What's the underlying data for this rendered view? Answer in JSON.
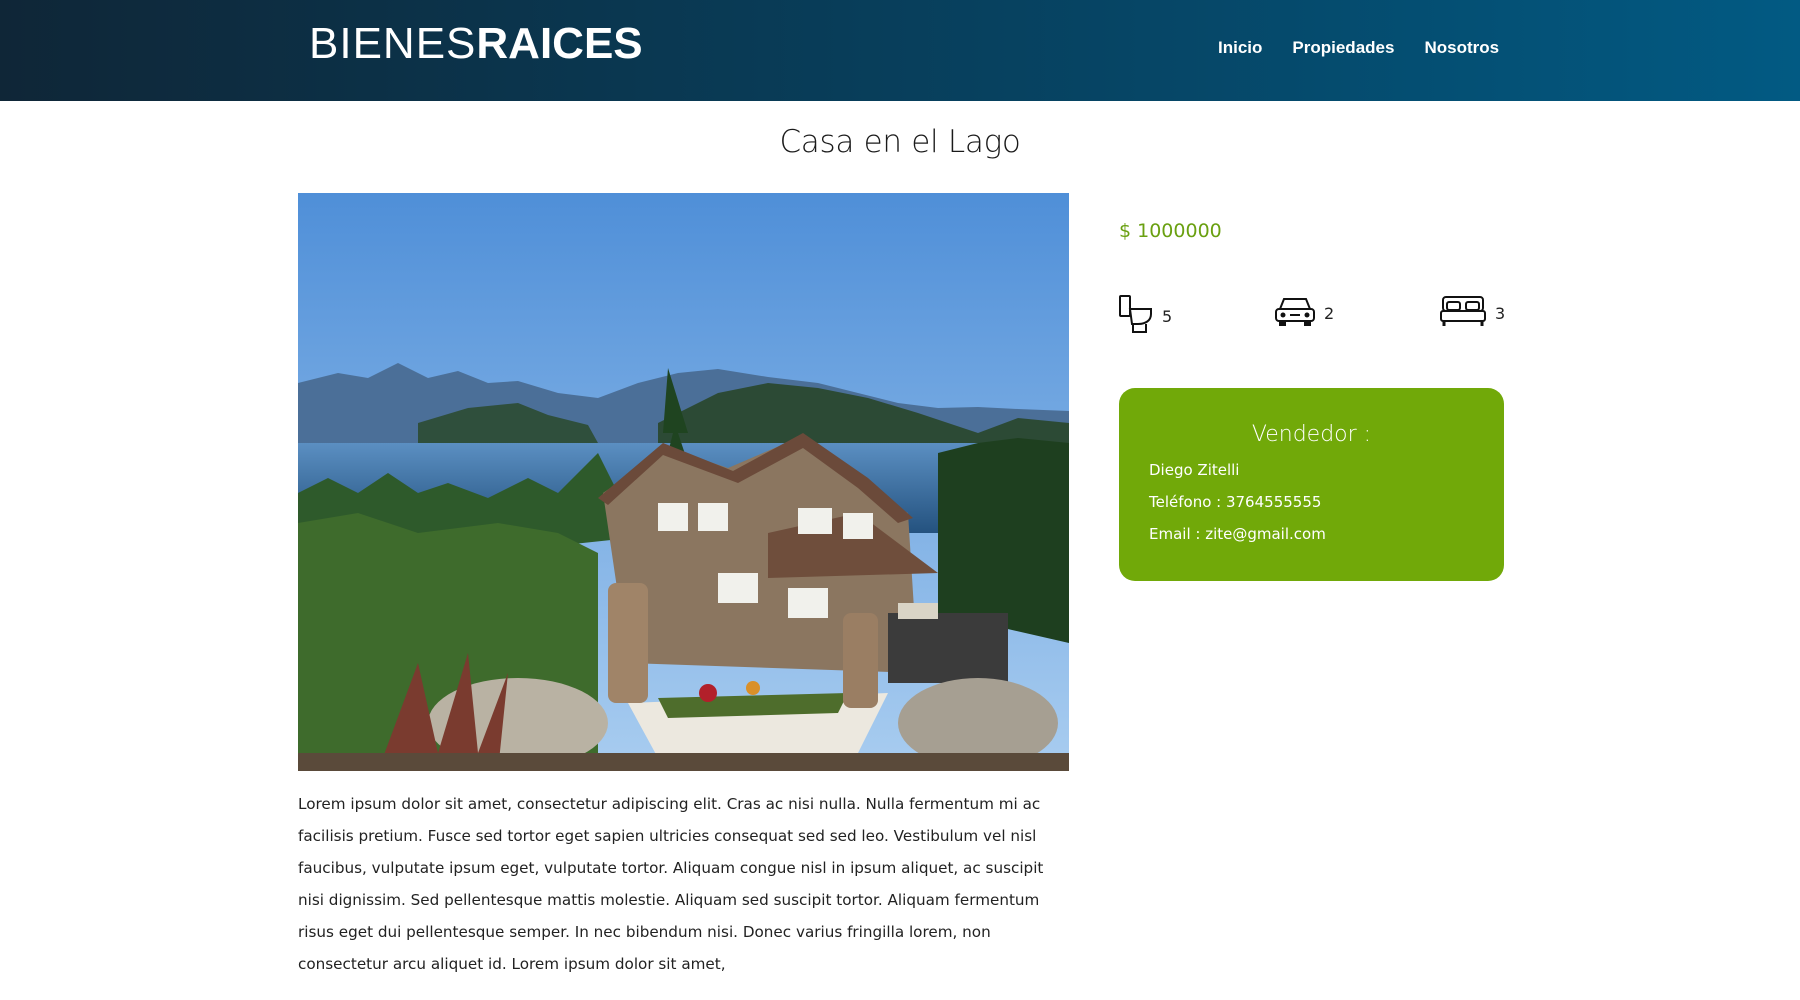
{
  "header": {
    "logo_light": "BIENES",
    "logo_bold": "RAICES",
    "nav": [
      "Inicio",
      "Propiedades",
      "Nosotros"
    ]
  },
  "property": {
    "title": "Casa en el Lago",
    "price": "$ 1000000",
    "features": [
      {
        "icon": "toilet-icon",
        "value": "5"
      },
      {
        "icon": "car-icon",
        "value": "2"
      },
      {
        "icon": "bed-icon",
        "value": "3"
      }
    ],
    "description": "Lorem ipsum dolor sit amet, consectetur adipiscing elit. Cras ac nisi nulla. Nulla fermentum mi ac facilisis pretium. Fusce sed tortor eget sapien ultricies consequat sed sed leo. Vestibulum vel nisl faucibus, vulputate ipsum eget, vulputate tortor. Aliquam congue nisl in ipsum aliquet, ac suscipit nisi dignissim. Sed pellentesque mattis molestie. Aliquam sed suscipit tortor. Aliquam fermentum risus eget dui pellentesque semper. In nec bibendum nisi. Donec varius fringilla lorem, non consectetur arcu aliquet id. Lorem ipsum dolor sit amet,"
  },
  "seller": {
    "heading": "Vendedor :",
    "name": "Diego Zitelli",
    "phone": "Teléfono : 3764555555",
    "email": "Email : zite@gmail.com"
  },
  "colors": {
    "accent_green": "#71a909",
    "price_green": "#6aa011",
    "header_dark": "#0f2637",
    "header_blue": "#025a83"
  }
}
